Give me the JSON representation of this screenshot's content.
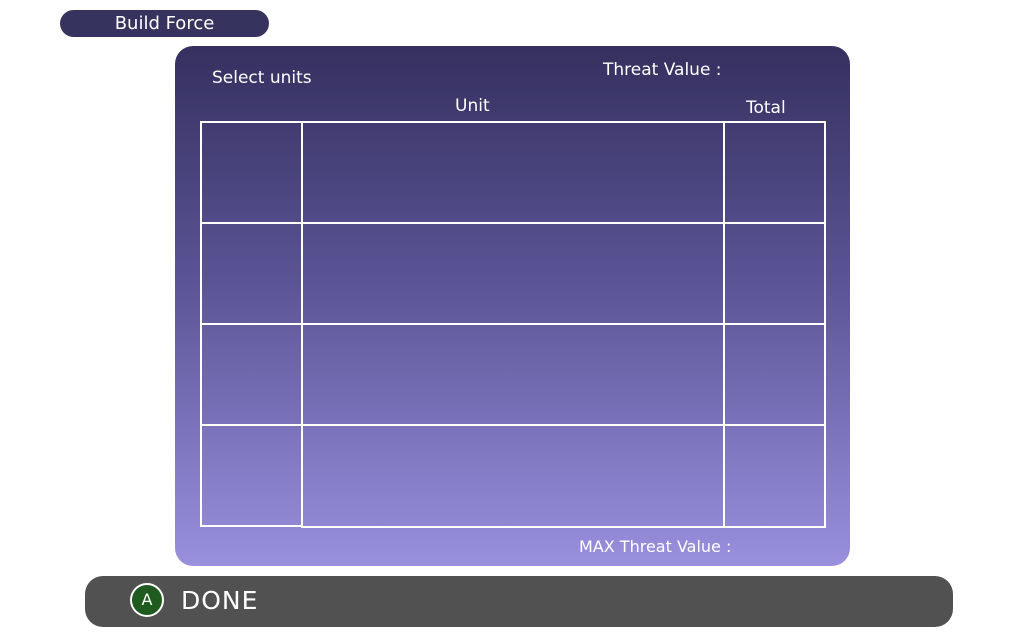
{
  "header": {
    "title": "Build Force"
  },
  "panel": {
    "select_units_label": "Select units",
    "threat_value_label": "Threat Value :",
    "unit_column_header": "Unit",
    "total_column_header": "Total",
    "max_threat_label": "MAX Threat Value :",
    "rows": [
      {
        "icon": "",
        "unit": "",
        "total": ""
      },
      {
        "icon": "",
        "unit": "",
        "total": ""
      },
      {
        "icon": "",
        "unit": "",
        "total": ""
      },
      {
        "icon": "",
        "unit": "",
        "total": ""
      }
    ]
  },
  "footer": {
    "button_glyph": "A",
    "done_label": "DONE"
  },
  "colors": {
    "panel_top": "#35305f",
    "panel_bottom": "#9990de",
    "title_pill": "#37335f",
    "footer_bar": "#515151",
    "a_button": "#1f5a1f"
  }
}
